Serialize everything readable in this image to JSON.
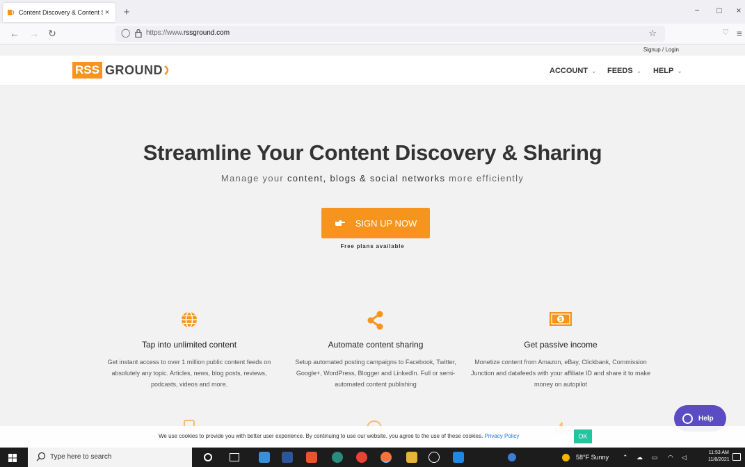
{
  "browser": {
    "tab_title": "Content Discovery & Content Sl",
    "tab_close": "×",
    "new_tab": "+",
    "url_prefix": "https://www.",
    "url_domain": "rssground.com",
    "window_controls": [
      "−",
      "□",
      "×"
    ]
  },
  "site": {
    "signup_login": "Signup / Login",
    "logo_rss": "RSS",
    "logo_ground": "GROUND",
    "menu": [
      {
        "label": "ACCOUNT",
        "caret": "⌄"
      },
      {
        "label": "FEEDS",
        "caret": "⌄"
      },
      {
        "label": "HELP",
        "caret": "⌄"
      }
    ],
    "brand_color": "#f7941d"
  },
  "hero": {
    "title": "Streamline Your Content Discovery & Sharing",
    "subtitle_a": "Manage your ",
    "subtitle_b": "content, blogs & social networks",
    "subtitle_c": " more efficiently",
    "cta": "SIGN UP NOW",
    "free_note": "Free plans available"
  },
  "features": [
    {
      "icon": "globe-icon",
      "title": "Tap into unlimited content",
      "desc": "Get instant access to over 1 million public content feeds on absolutely any topic. Articles, news, blog posts, reviews, podcasts, videos and more."
    },
    {
      "icon": "share-icon",
      "title": "Automate content sharing",
      "desc": "Setup automated posting campaigns to Facebook, Twitter, Google+, WordPress, Blogger and LinkedIn. Full or semi-automated content publishing"
    },
    {
      "icon": "money-icon",
      "title": "Get passive income",
      "desc": "Monetize content from Amazon, eBay, Clickbank, Commission Junction and datafeeds with your affiliate ID and share it to make money on autopilot"
    }
  ],
  "help_widget": "Help",
  "cookie": {
    "text": "We use cookies to provide you with better user experience. By continuing to use our website, you agree to the use of these cookies. ",
    "link": "Privacy Policy",
    "ok": "OK"
  },
  "taskbar": {
    "search_placeholder": "Type here to search",
    "weather": "58°F  Sunny",
    "time": "11:53 AM",
    "date": "11/8/2021"
  }
}
